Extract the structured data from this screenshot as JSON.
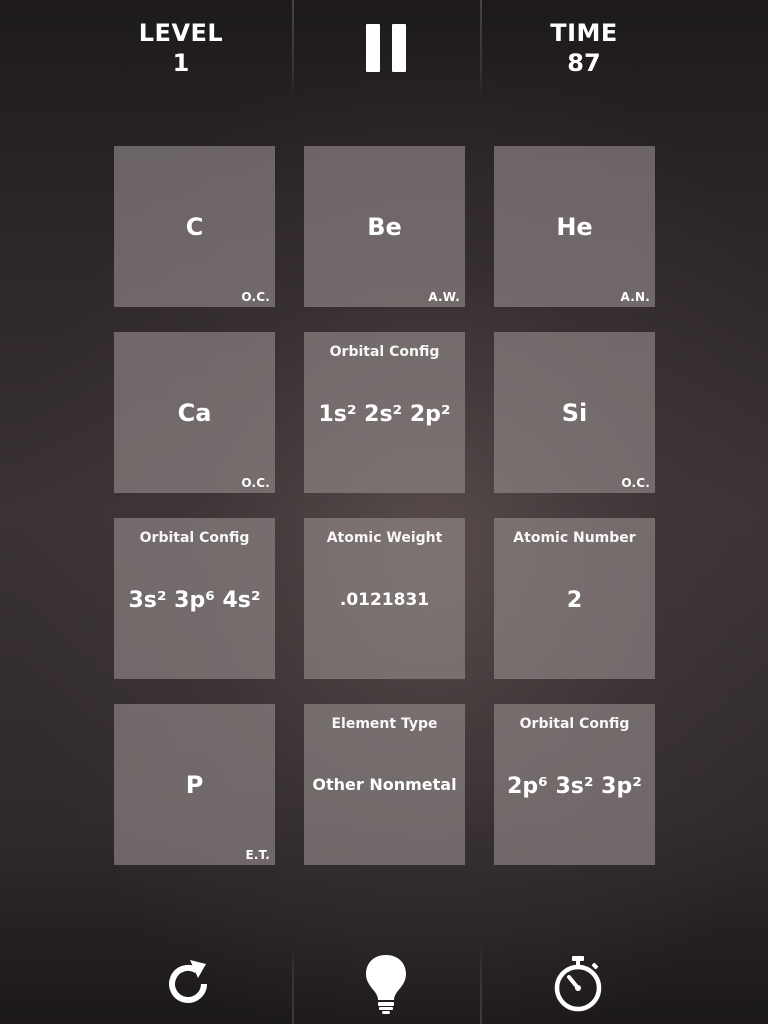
{
  "hud": {
    "level_label": "LEVEL",
    "level_value": "1",
    "time_label": "TIME",
    "time_value": "87",
    "pause_icon": "pause-icon"
  },
  "tiles": [
    {
      "main": "C",
      "tag": "O.C."
    },
    {
      "main": "Be",
      "tag": "A.W."
    },
    {
      "main": "He",
      "tag": "A.N."
    },
    {
      "main": "Ca",
      "tag": "O.C."
    },
    {
      "heading": "Orbital Config",
      "body": "1s² 2s² 2p²"
    },
    {
      "main": "Si",
      "tag": "O.C."
    },
    {
      "heading": "Orbital Config",
      "body": "3s² 3p⁶ 4s²"
    },
    {
      "heading": "Atomic Weight",
      "body": ".0121831"
    },
    {
      "heading": "Atomic Number",
      "body": "2"
    },
    {
      "main": "P",
      "tag": "E.T."
    },
    {
      "heading": "Element Type",
      "body": "Other Nonmetal"
    },
    {
      "heading": "Orbital Config",
      "body": "2p⁶ 3s² 3p²"
    }
  ],
  "controls": {
    "restart_icon": "restart-icon",
    "hint_icon": "lightbulb-icon",
    "timer_icon": "stopwatch-icon"
  },
  "colors": {
    "tile": "#8f8788",
    "text": "#ffffff",
    "background": "#2a2527"
  }
}
